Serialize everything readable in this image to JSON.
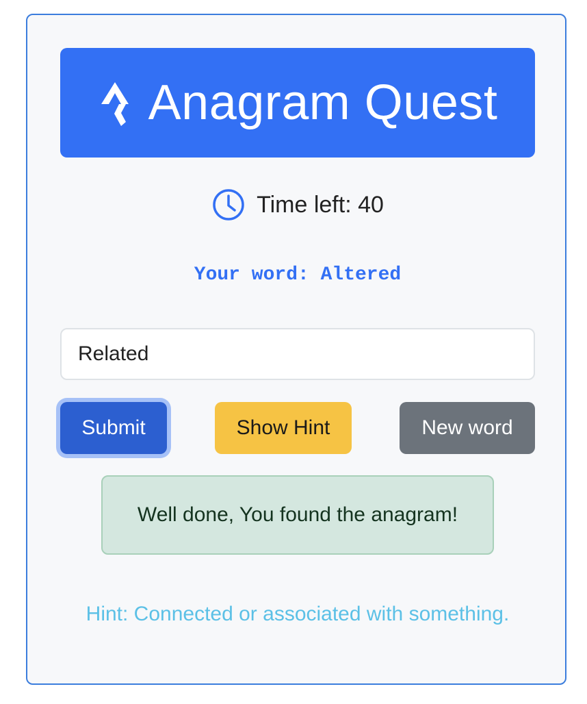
{
  "header": {
    "title": "Anagram Quest",
    "logo_icon": "strava-arrows-icon",
    "color": "#3370f4"
  },
  "timer": {
    "icon": "clock-icon",
    "text": "Time left: 40"
  },
  "word": {
    "text": "Your word: Altered"
  },
  "answer_input": {
    "value": "Related"
  },
  "buttons": {
    "submit": "Submit",
    "hint": "Show Hint",
    "new_word": "New word"
  },
  "alert": {
    "text": "Well done, You found the anagram!"
  },
  "hint": {
    "text": "Hint: Connected or associated with something."
  },
  "colors": {
    "primary": "#3370f4",
    "warning": "#f6c344",
    "secondary": "#6c737b",
    "success_bg": "#d4e7df",
    "info_text": "#5bc0e6"
  }
}
